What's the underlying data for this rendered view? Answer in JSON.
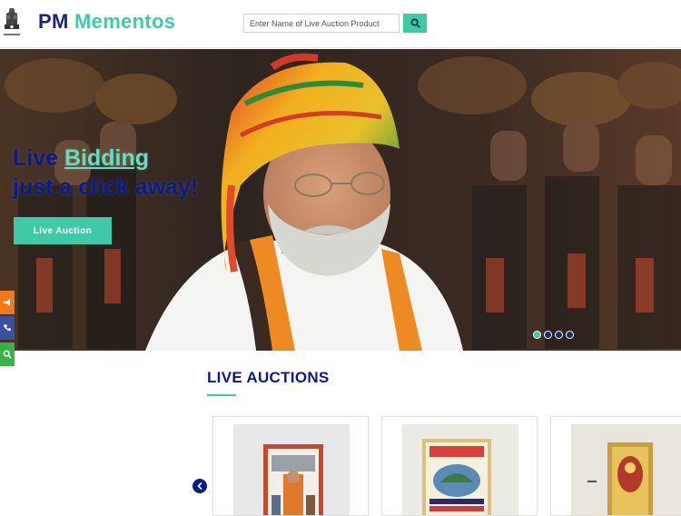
{
  "header": {
    "brand_pm": "PM",
    "brand_mementos": "Mementos",
    "emblem_caption": "सत्यमेव जयते",
    "search_placeholder": "Enter Name of Live Auction Product",
    "search_icon": "search-icon"
  },
  "hero": {
    "line1_prefix": "Live ",
    "line1_highlight": "Bidding",
    "line2": "just a click away!",
    "button_label": "Live Auction",
    "slides_total": 4,
    "active_slide": 1
  },
  "side_buttons": [
    {
      "icon": "megaphone-icon",
      "color": "#f07a1a"
    },
    {
      "icon": "phone-icon",
      "color": "#3a51a3"
    },
    {
      "icon": "search-icon",
      "color": "#3db04b"
    }
  ],
  "auctions": {
    "title": "LIVE AUCTIONS",
    "prev_icon": "chevron-left-icon"
  },
  "colors": {
    "accent": "#3ec9a7",
    "navy": "#0d1a8a"
  }
}
